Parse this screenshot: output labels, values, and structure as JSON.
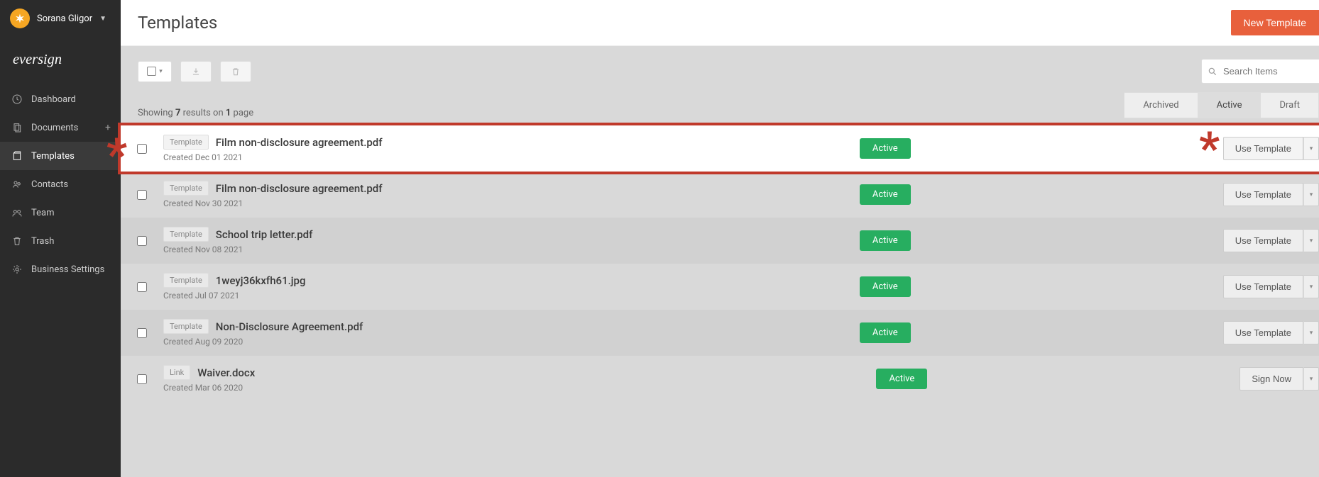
{
  "user": {
    "name": "Sorana Gligor"
  },
  "brand": "eversign",
  "sidebar": {
    "items": [
      {
        "label": "Dashboard"
      },
      {
        "label": "Documents"
      },
      {
        "label": "Templates"
      },
      {
        "label": "Contacts"
      },
      {
        "label": "Team"
      },
      {
        "label": "Trash"
      },
      {
        "label": "Business Settings"
      }
    ]
  },
  "header": {
    "title": "Templates",
    "primary_button": "New Template"
  },
  "toolbar": {
    "search_placeholder": "Search Items"
  },
  "list_meta": {
    "prefix": "Showing ",
    "count": "7",
    "mid": " results on ",
    "pages": "1",
    "suffix": " page"
  },
  "tabs": {
    "archived": "Archived",
    "active": "Active",
    "draft": "Draft"
  },
  "badges": {
    "template": "Template",
    "link": "Link"
  },
  "actions": {
    "use": "Use Template",
    "sign": "Sign Now"
  },
  "status": {
    "active": "Active"
  },
  "rows": [
    {
      "badge": "template",
      "name": "Film non-disclosure agreement.pdf",
      "meta": "Created Dec 01 2021",
      "action": "use",
      "highlight": true
    },
    {
      "badge": "template",
      "name": "Film non-disclosure agreement.pdf",
      "meta": "Created Nov 30 2021",
      "action": "use"
    },
    {
      "badge": "template",
      "name": "School trip letter.pdf",
      "meta": "Created Nov 08 2021",
      "action": "use"
    },
    {
      "badge": "template",
      "name": "1weyj36kxfh61.jpg",
      "meta": "Created Jul 07 2021",
      "action": "use"
    },
    {
      "badge": "template",
      "name": "Non-Disclosure Agreement.pdf",
      "meta": "Created Aug 09 2020",
      "action": "use"
    },
    {
      "badge": "link",
      "name": "Waiver.docx",
      "meta": "Created Mar 06 2020",
      "action": "sign"
    }
  ]
}
